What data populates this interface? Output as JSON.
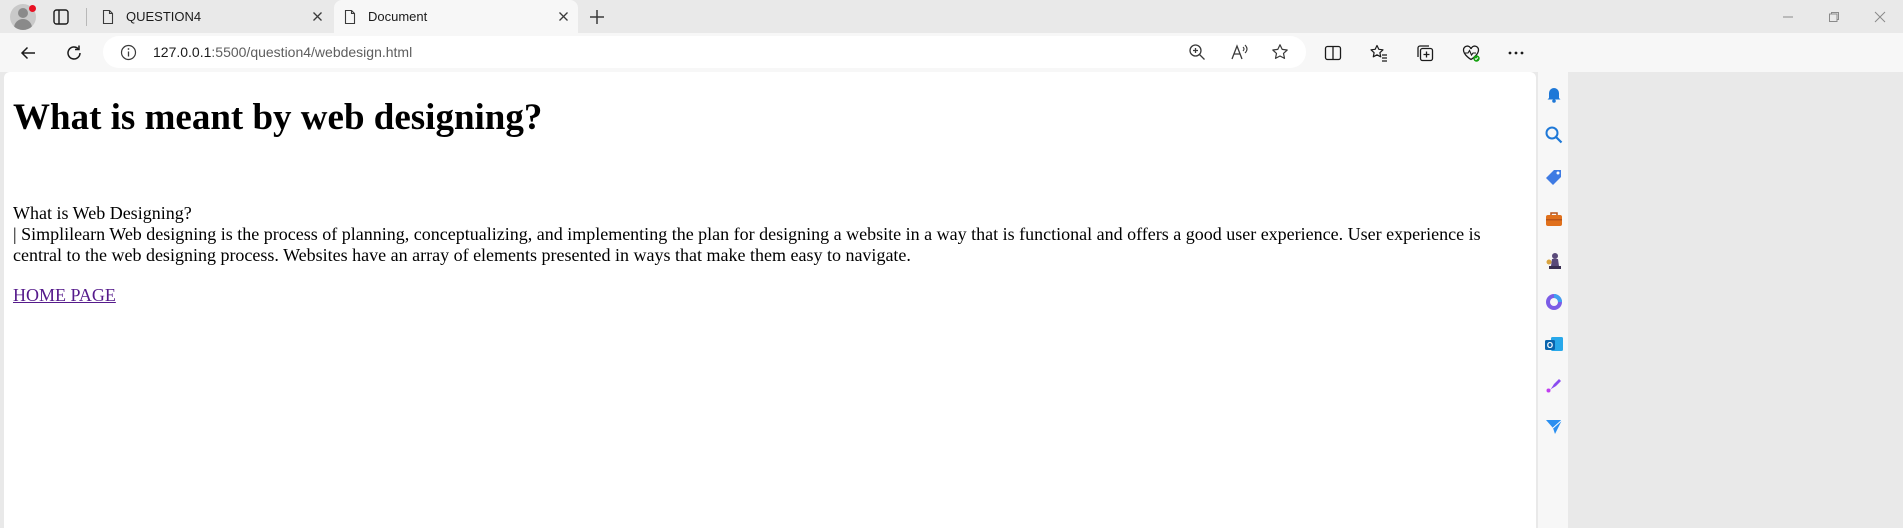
{
  "browser": {
    "tabs": [
      {
        "title": "QUESTION4",
        "active": false
      },
      {
        "title": "Document",
        "active": true
      }
    ],
    "address": {
      "host": "127.0.0.1",
      "path": ":5500/question4/webdesign.html"
    },
    "icons": {
      "profile": "profile-avatar-icon",
      "tab_actions": "tab-actions-icon",
      "new_tab": "plus-icon",
      "back": "back-arrow-icon",
      "refresh": "refresh-icon",
      "info": "info-icon",
      "zoom": "zoom-icon",
      "read_aloud": "read-aloud-icon",
      "favorite": "star-icon",
      "split_screen": "split-screen-icon",
      "favorites": "favorites-icon",
      "collections": "collections-icon",
      "performance": "heart-icon",
      "more": "more-icon",
      "copilot": "copilot-icon"
    },
    "colors": {
      "accent": "#0078d4",
      "visited_link": "#551a8b"
    }
  },
  "page": {
    "heading": "What is meant by web designing?",
    "question": "What is Web Designing?",
    "paragraph": "| Simplilearn Web designing is the process of planning, conceptualizing, and implementing the plan for designing a website in a way that is functional and offers a good user experience. User experience is central to the web designing process. Websites have an array of elements presented in ways that make them easy to navigate.",
    "link": "HOME PAGE"
  },
  "sidebar": {
    "items": [
      "bell-icon",
      "search-icon",
      "tag-icon",
      "briefcase-icon",
      "chess-icon",
      "office-icon",
      "outlook-icon",
      "designer-icon",
      "send-icon"
    ]
  }
}
